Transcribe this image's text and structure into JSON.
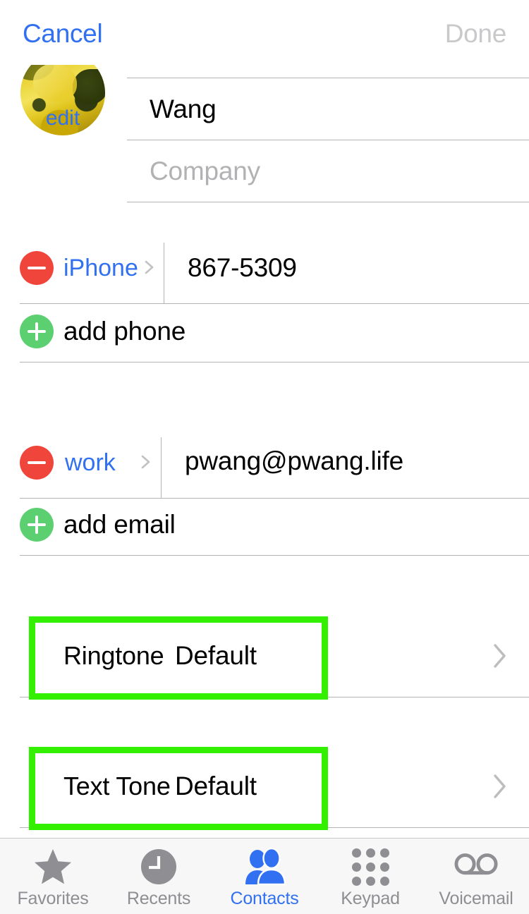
{
  "navbar": {
    "cancel_label": "Cancel",
    "done_label": "Done",
    "cancel_color": "#3170f0",
    "done_color": "#c9c9cb"
  },
  "avatar": {
    "edit_label": "edit",
    "image_description": "sunflower photo"
  },
  "name_fields": [
    {
      "value": "Wang",
      "placeholder": "Last name",
      "is_placeholder": false
    },
    {
      "value": "Company",
      "placeholder": "Company",
      "is_placeholder": true
    }
  ],
  "phone_section": {
    "entries": [
      {
        "label": "iPhone",
        "value": "867-5309",
        "remove_icon": "minus-circle-icon",
        "disclosure_icon": "chevron-right-icon"
      }
    ],
    "add_label": "add phone",
    "add_icon": "plus-circle-icon"
  },
  "email_section": {
    "entries": [
      {
        "label": "work",
        "value": "pwang@pwang.life",
        "remove_icon": "minus-circle-icon",
        "disclosure_icon": "chevron-right-icon"
      }
    ],
    "add_label": "add email",
    "add_icon": "plus-circle-icon"
  },
  "tone_rows": [
    {
      "label": "Ringtone",
      "value": "Default",
      "highlighted": true,
      "disclosure_icon": "chevron-right-icon"
    },
    {
      "label": "Text Tone",
      "value": "Default",
      "highlighted": true,
      "disclosure_icon": "chevron-right-icon"
    }
  ],
  "highlight": {
    "color": "#33ef00",
    "border_width_px": 9
  },
  "tabbar": {
    "active_index": 2,
    "active_color": "#3170f0",
    "inactive_color": "#8e8e93",
    "items": [
      {
        "label": "Favorites",
        "icon": "star-icon"
      },
      {
        "label": "Recents",
        "icon": "clock-icon"
      },
      {
        "label": "Contacts",
        "icon": "people-icon"
      },
      {
        "label": "Keypad",
        "icon": "keypad-grid-icon"
      },
      {
        "label": "Voicemail",
        "icon": "voicemail-icon"
      }
    ]
  },
  "colors": {
    "remove_red": "#f0453a",
    "add_green": "#5cd071",
    "link_blue": "#3170f0",
    "hairline": "#b3b3b5",
    "tabbar_bg": "#f7f7f7"
  }
}
